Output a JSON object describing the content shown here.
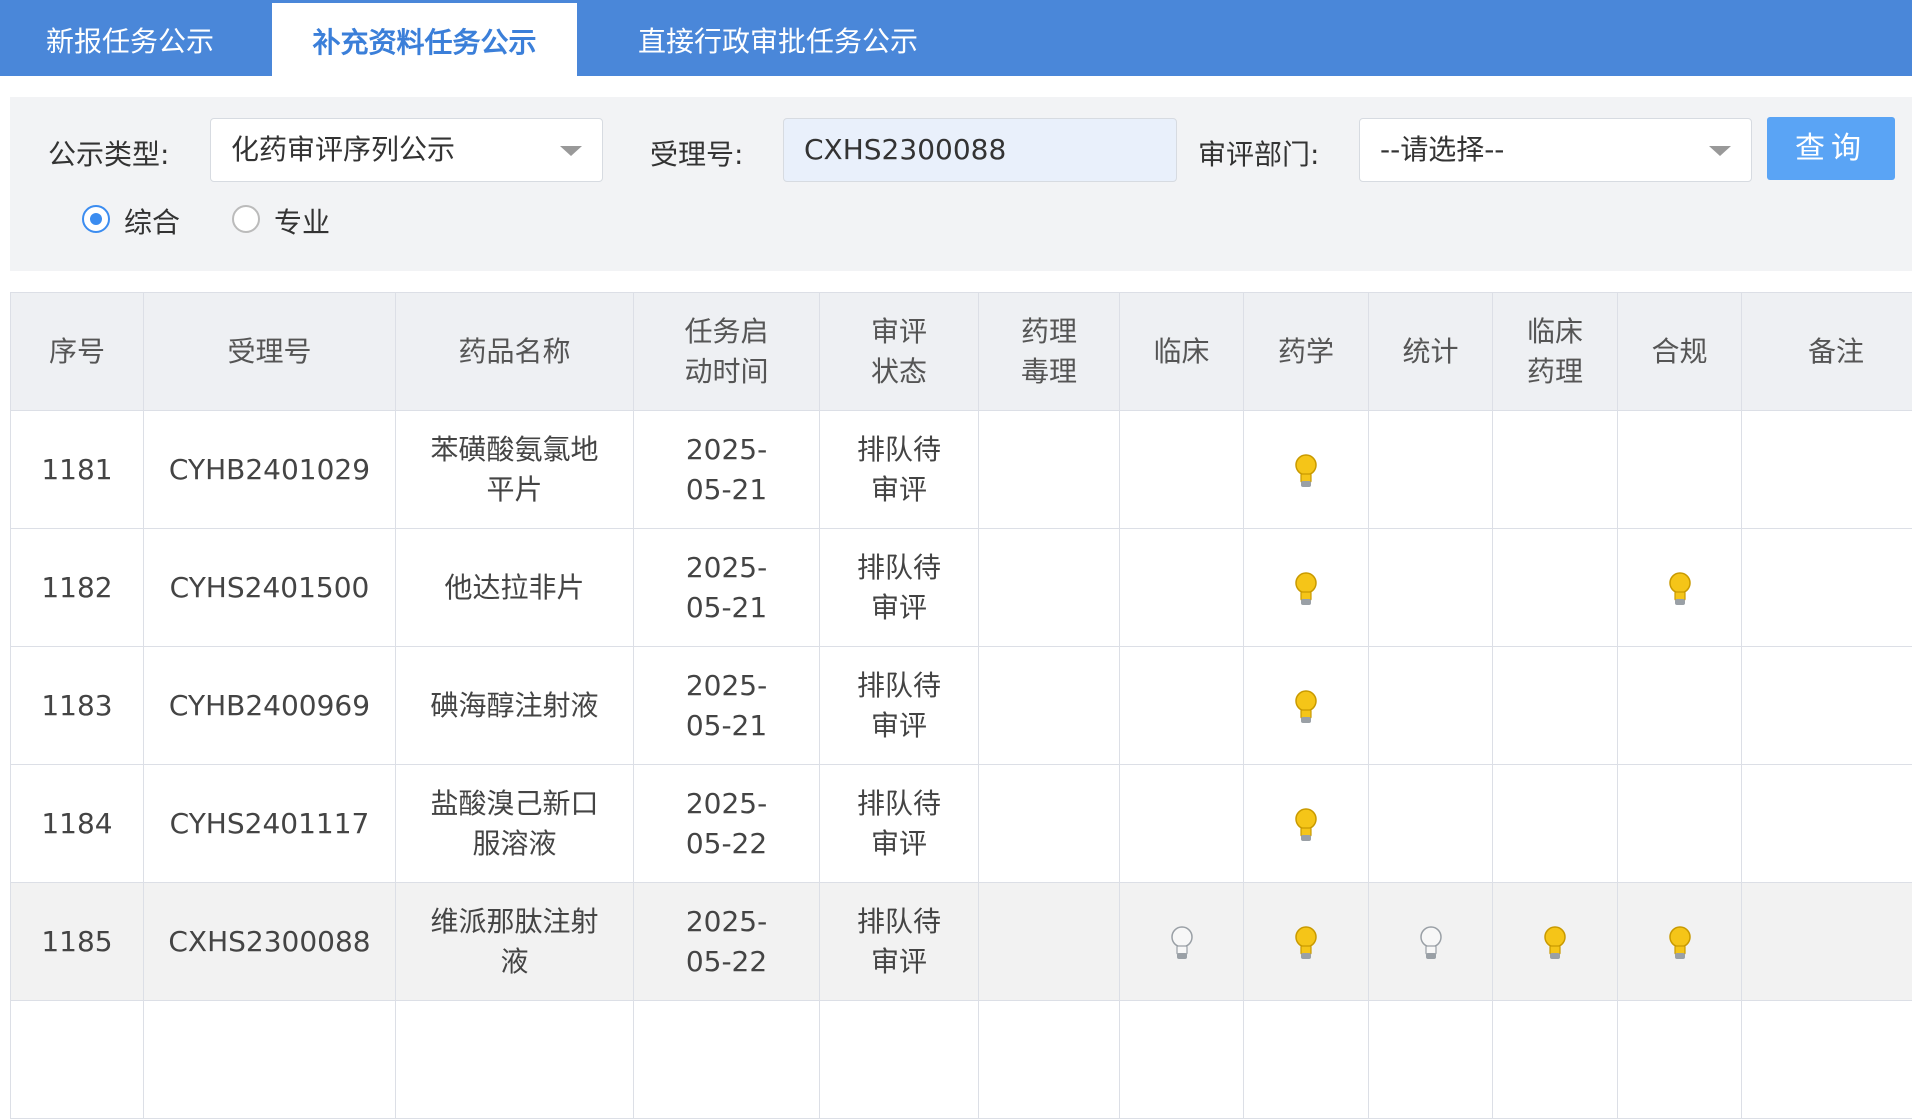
{
  "tabs": [
    {
      "label": "新报任务公示"
    },
    {
      "label": "补充资料任务公示"
    },
    {
      "label": "直接行政审批任务公示"
    }
  ],
  "filter": {
    "type_label": "公示类型:",
    "type_value": "化药审评序列公示",
    "accept_label": "受理号:",
    "accept_value": "CXHS2300088",
    "dept_label": "审评部门:",
    "dept_value": "--请选择--",
    "query_button": "查询",
    "radio_comprehensive": "综合",
    "radio_professional": "专业"
  },
  "table": {
    "headers": [
      "序号",
      "受理号",
      "药品名称",
      "任务启动时间",
      "审评状态",
      "药理毒理",
      "临床",
      "药学",
      "统计",
      "临床药理",
      "合规",
      "备注"
    ],
    "rows": [
      {
        "no": "1181",
        "accept": "CYHB2401029",
        "name": "苯磺酸氨氯地平片",
        "date": "2025-05-21",
        "status": "排队待审评"
      },
      {
        "no": "1182",
        "accept": "CYHS2401500",
        "name": "他达拉非片",
        "date": "2025-05-21",
        "status": "排队待审评"
      },
      {
        "no": "1183",
        "accept": "CYHB2400969",
        "name": "碘海醇注射液",
        "date": "2025-05-21",
        "status": "排队待审评"
      },
      {
        "no": "1184",
        "accept": "CYHS2401117",
        "name": "盐酸溴己新口服溶液",
        "date": "2025-05-22",
        "status": "排队待审评"
      },
      {
        "no": "1185",
        "accept": "CXHS2300088",
        "name": "维派那肽注射液",
        "date": "2025-05-22",
        "status": "排队待审评"
      }
    ]
  },
  "icons": {
    "bulb_on": "lightbulb-lit-icon",
    "bulb_off": "lightbulb-unlit-icon",
    "dropdown": "chevron-down-icon"
  },
  "colors": {
    "tab_bar": "#4a87d9",
    "active_tab_text": "#3b7fd9",
    "query_button": "#5aa4f5",
    "highlight_text": "#c8102e",
    "bulb_lit": "#f5c518"
  }
}
